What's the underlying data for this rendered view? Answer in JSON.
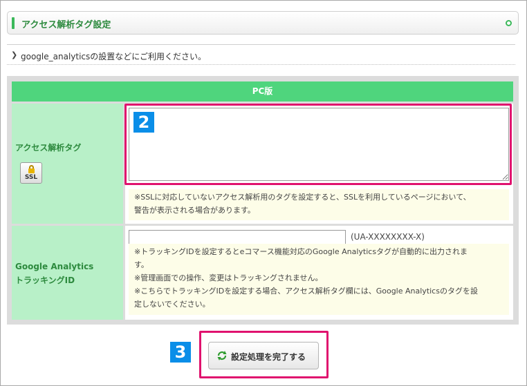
{
  "header": {
    "title": "アクセス解析タグ設定"
  },
  "info": {
    "text": "google_analyticsの設置などにご利用ください。"
  },
  "table": {
    "heading": "PC版",
    "rows": [
      {
        "label": "アクセス解析タグ",
        "badge": "SSL",
        "notes": [
          "※SSLに対応していないアクセス解析用のタグを設定すると、SSLを利用しているページにおいて、",
          "警告が表示される場合があります。"
        ]
      },
      {
        "label_line1": "Google Analytics",
        "label_line2": "トラッキングID",
        "input_value": "",
        "suffix": "(UA-XXXXXXXX-X)",
        "notes": [
          "※トラッキングIDを設定するとeコマース機能対応のGoogle Analyticsタグが自動的に出力されま",
          "す。",
          "※管理画面での操作、変更はトラッキングされません。",
          "※こちらでトラッキングIDを設定する場合、アクセス解析タグ欄には、Google Analyticsのタグを設",
          "定しないでください。"
        ]
      }
    ]
  },
  "markers": {
    "step2": "2",
    "step3": "3"
  },
  "submit": {
    "label": "設定処理を完了する"
  },
  "colors": {
    "accent_green": "#4fd57d",
    "highlight": "#e0126e",
    "marker_blue": "#0a8ee8"
  }
}
